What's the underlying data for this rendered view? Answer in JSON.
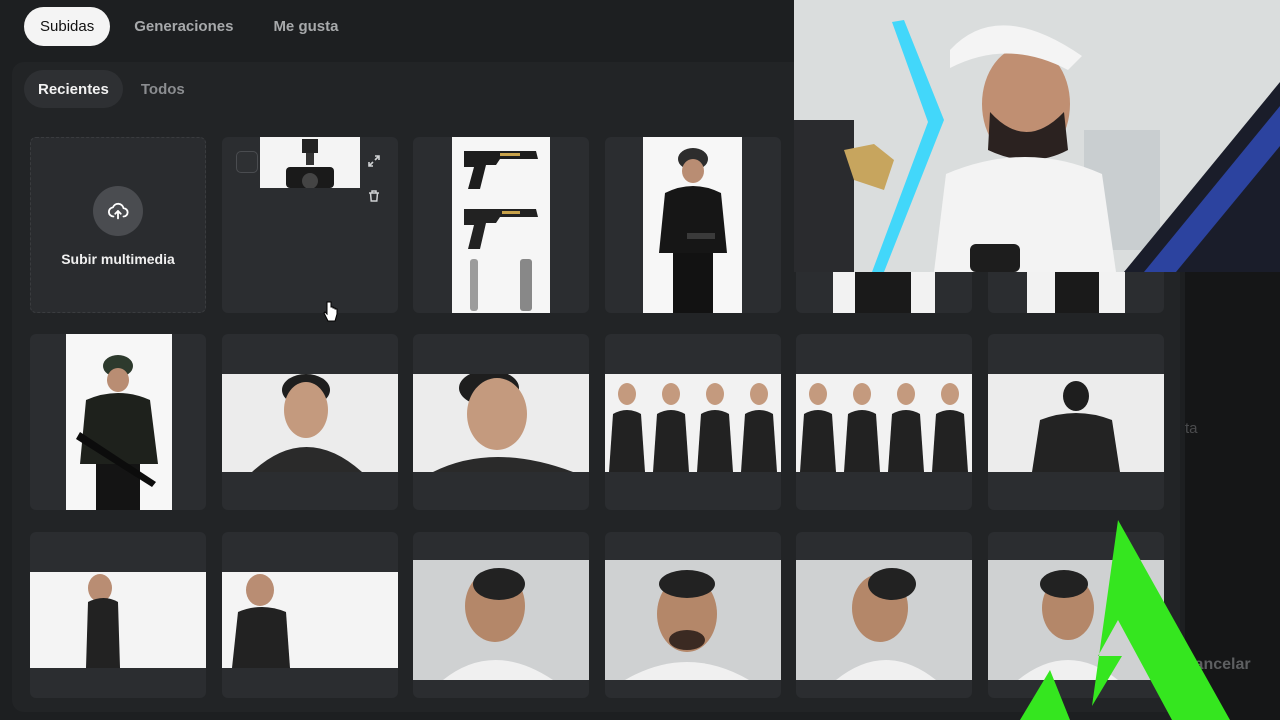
{
  "top_tabs": [
    {
      "label": "Subidas",
      "active": true
    },
    {
      "label": "Generaciones",
      "active": false
    },
    {
      "label": "Me gusta",
      "active": false
    }
  ],
  "sub_tabs": [
    {
      "label": "Recientes",
      "active": true
    },
    {
      "label": "Todos",
      "active": false
    }
  ],
  "upload": {
    "label": "Subir multimedia",
    "icon": "cloud-upload-icon"
  },
  "side_panel": {
    "partial_text": "ta",
    "cancel_label": "Cancelar"
  },
  "colors": {
    "accent_green": "#35e61f",
    "panel": "#1d1f21",
    "tile": "#2b2d30",
    "active_pill": "#f4f4f4"
  },
  "media_items": [
    "camera-flash-photo",
    "pistols-photo",
    "armed-guard-photo",
    "guard-partial-1",
    "guard-partial-2",
    "armed-guard-rifle-photo",
    "man-face-front-photo",
    "man-face-down-photo",
    "man-turnaround-4-photo",
    "man-turnaround-4b-photo",
    "man-back-photo",
    "man-profile-left-photo",
    "man-profile-right-photo",
    "bearded-man-profile-photo",
    "bearded-man-front-photo",
    "bearded-man-profile-2-photo",
    "bearded-man-3q-photo"
  ]
}
